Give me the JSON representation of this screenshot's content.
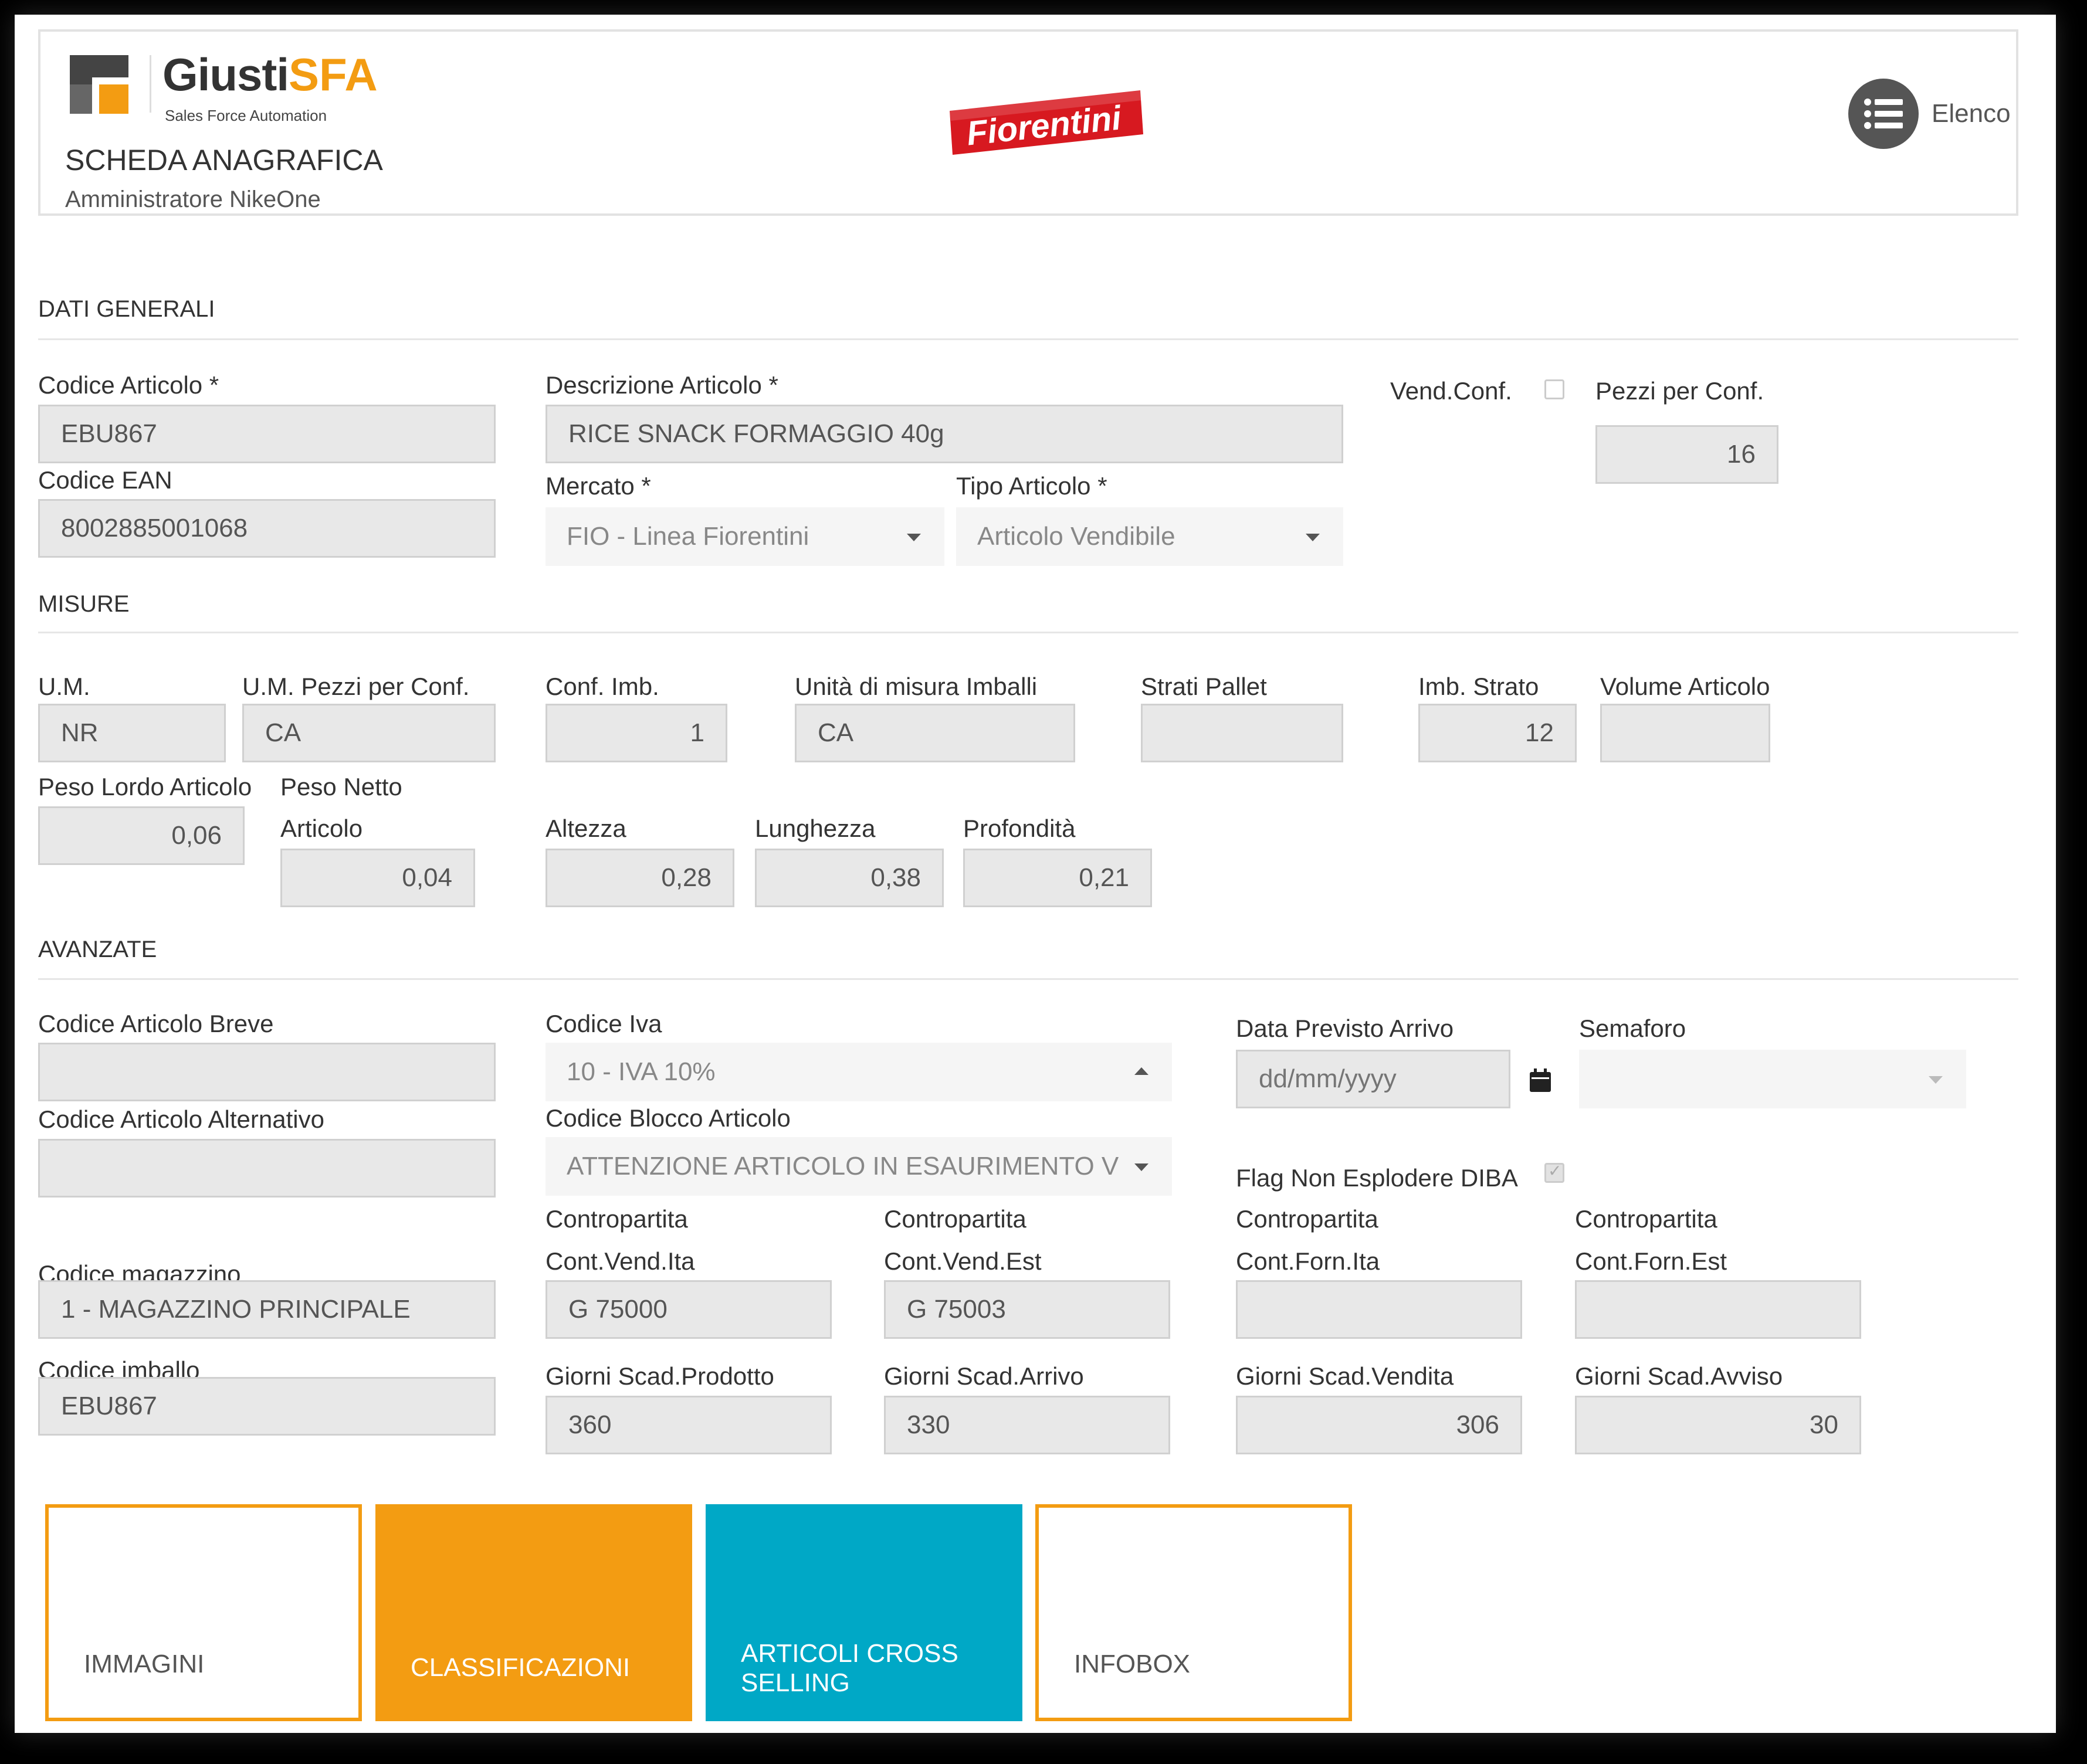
{
  "header": {
    "brand_name": "Giusti",
    "brand_suffix": "SFA",
    "brand_tagline": "Sales Force Automation",
    "page_title": "SCHEDA ANAGRAFICA",
    "user": "Amministratore NikeOne",
    "partner_logo_text": "Fiorentini",
    "list_button_label": "Elenco",
    "list_icon": "list-icon",
    "colors": {
      "accent": "#f39c12",
      "partner_red": "#d71920",
      "teal": "#00a8c6"
    }
  },
  "sections": {
    "general": "DATI GENERALI",
    "measures": "MISURE",
    "advanced": "AVANZATE"
  },
  "general": {
    "codice_articolo": {
      "label": "Codice Articolo *",
      "value": "EBU867"
    },
    "descrizione_articolo": {
      "label": "Descrizione Articolo *",
      "value": "RICE SNACK FORMAGGIO 40g"
    },
    "vend_conf": {
      "label": "Vend.Conf.",
      "checked": false
    },
    "pezzi_per_conf": {
      "label": "Pezzi per Conf.",
      "value": "16"
    },
    "codice_ean": {
      "label": "Codice EAN",
      "value": "8002885001068"
    },
    "mercato": {
      "label": "Mercato *",
      "value": "FIO - Linea Fiorentini"
    },
    "tipo_articolo": {
      "label": "Tipo Articolo *",
      "value": "Articolo Vendibile"
    }
  },
  "measures": {
    "um": {
      "label": "U.M.",
      "value": "NR"
    },
    "um_pezzi": {
      "label": "U.M. Pezzi per Conf.",
      "value": "CA"
    },
    "conf_imb": {
      "label": "Conf. Imb.",
      "value": "1"
    },
    "um_imballi": {
      "label": "Unità di misura Imballi",
      "value": "CA"
    },
    "strati_pallet": {
      "label": "Strati Pallet",
      "value": ""
    },
    "imb_strato": {
      "label": "Imb. Strato",
      "value": "12"
    },
    "volume_articolo": {
      "label": "Volume Articolo",
      "value": ""
    },
    "peso_lordo": {
      "label": "Peso Lordo Articolo",
      "value": "0,06"
    },
    "peso_netto": {
      "label_line1": "Peso Netto",
      "label_line2": "Articolo",
      "value": "0,04"
    },
    "altezza": {
      "label": "Altezza",
      "value": "0,28"
    },
    "lunghezza": {
      "label": "Lunghezza",
      "value": "0,38"
    },
    "profondita": {
      "label": "Profondità",
      "value": "0,21"
    }
  },
  "advanced": {
    "codice_breve": {
      "label": "Codice Articolo Breve",
      "value": ""
    },
    "codice_iva": {
      "label": "Codice Iva",
      "value": "10 - IVA 10%"
    },
    "data_previsto_arrivo": {
      "label": "Data Previsto Arrivo",
      "placeholder": "dd/mm/yyyy"
    },
    "semaforo": {
      "label": "Semaforo",
      "value": ""
    },
    "codice_alternativo": {
      "label": "Codice Articolo Alternativo",
      "value": ""
    },
    "codice_blocco": {
      "label": "Codice Blocco Articolo",
      "value": "ATTENZIONE ARTICOLO IN ESAURIMENTO V"
    },
    "flag_diba": {
      "label": "Flag Non Esplodere DIBA",
      "checked": true
    },
    "cp_vend_ita": {
      "label_line1": "Contropartita",
      "label_line2": "Cont.Vend.Ita",
      "value": "G 75000"
    },
    "cp_vend_est": {
      "label_line1": "Contropartita",
      "label_line2": "Cont.Vend.Est",
      "value": "G 75003"
    },
    "cp_forn_ita": {
      "label_line1": "Contropartita",
      "label_line2": "Cont.Forn.Ita",
      "value": ""
    },
    "cp_forn_est": {
      "label_line1": "Contropartita",
      "label_line2": "Cont.Forn.Est",
      "value": ""
    },
    "codice_magazzino": {
      "label": "Codice magazzino",
      "value": "1 - MAGAZZINO PRINCIPALE"
    },
    "codice_imballo": {
      "label": "Codice imballo",
      "value": "EBU867"
    },
    "gg_scad_prodotto": {
      "label": "Giorni Scad.Prodotto",
      "value": "360"
    },
    "gg_scad_arrivo": {
      "label": "Giorni Scad.Arrivo",
      "value": "330"
    },
    "gg_scad_vendita": {
      "label": "Giorni Scad.Vendita",
      "value": "306"
    },
    "gg_scad_avviso": {
      "label": "Giorni Scad.Avviso",
      "value": "30"
    }
  },
  "tiles": {
    "immagini": "IMMAGINI",
    "classificazioni": "CLASSIFICAZIONI",
    "cross_selling_line1": "ARTICOLI CROSS",
    "cross_selling_line2": "SELLING",
    "infobox": "INFOBOX"
  }
}
